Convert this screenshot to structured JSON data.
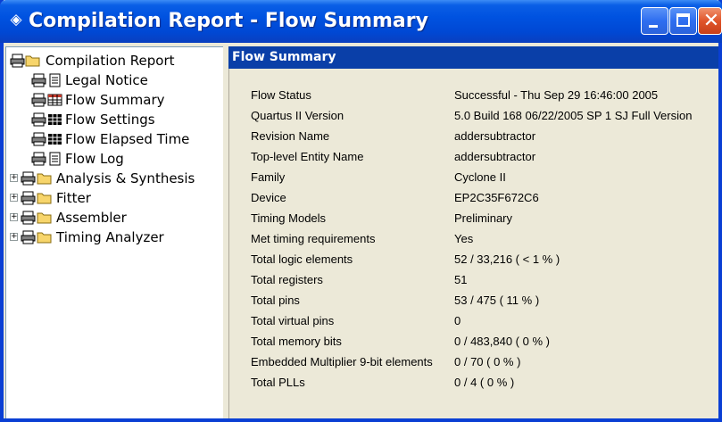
{
  "window": {
    "title": "Compilation Report - Flow Summary",
    "title_icon": "app-diamond-icon"
  },
  "tree": {
    "items": [
      {
        "label": "Compilation Report",
        "icon": "folder-icon",
        "expander": false
      },
      {
        "label": "Legal Notice",
        "icon": "document-icon",
        "expander": false
      },
      {
        "label": "Flow Summary",
        "icon": "table-icon",
        "expander": false
      },
      {
        "label": "Flow Settings",
        "icon": "table-icon",
        "expander": false
      },
      {
        "label": "Flow Elapsed Time",
        "icon": "table-icon",
        "expander": false
      },
      {
        "label": "Flow Log",
        "icon": "document-icon",
        "expander": false
      },
      {
        "label": "Analysis & Synthesis",
        "icon": "folder-icon",
        "expander": true
      },
      {
        "label": "Fitter",
        "icon": "folder-icon",
        "expander": true
      },
      {
        "label": "Assembler",
        "icon": "folder-icon",
        "expander": true
      },
      {
        "label": "Timing Analyzer",
        "icon": "folder-icon",
        "expander": true
      }
    ]
  },
  "report": {
    "header": "Flow Summary",
    "rows": [
      {
        "key": "Flow Status",
        "value": "Successful - Thu Sep 29 16:46:00 2005"
      },
      {
        "key": "Quartus II Version",
        "value": "5.0 Build 168 06/22/2005 SP 1 SJ Full Version"
      },
      {
        "key": "Revision Name",
        "value": "addersubtractor"
      },
      {
        "key": "Top-level Entity Name",
        "value": "addersubtractor"
      },
      {
        "key": "Family",
        "value": "Cyclone II"
      },
      {
        "key": "Device",
        "value": "EP2C35F672C6"
      },
      {
        "key": "Timing Models",
        "value": "Preliminary"
      },
      {
        "key": "Met timing requirements",
        "value": "Yes"
      },
      {
        "key": "Total logic elements",
        "value": "52 / 33,216 ( < 1 % )"
      },
      {
        "key": "Total registers",
        "value": "51"
      },
      {
        "key": "Total pins",
        "value": "53 / 475 ( 11 % )"
      },
      {
        "key": "Total virtual pins",
        "value": "0"
      },
      {
        "key": "Total memory bits",
        "value": "0 / 483,840 ( 0 % )"
      },
      {
        "key": "Embedded Multiplier 9-bit elements",
        "value": "0 / 70 ( 0 % )"
      },
      {
        "key": "Total PLLs",
        "value": "0 / 4 ( 0 % )"
      }
    ]
  },
  "colors": {
    "titlebar": "#0052e0",
    "report_header": "#0a3fa8",
    "close_button": "#e0552a"
  }
}
